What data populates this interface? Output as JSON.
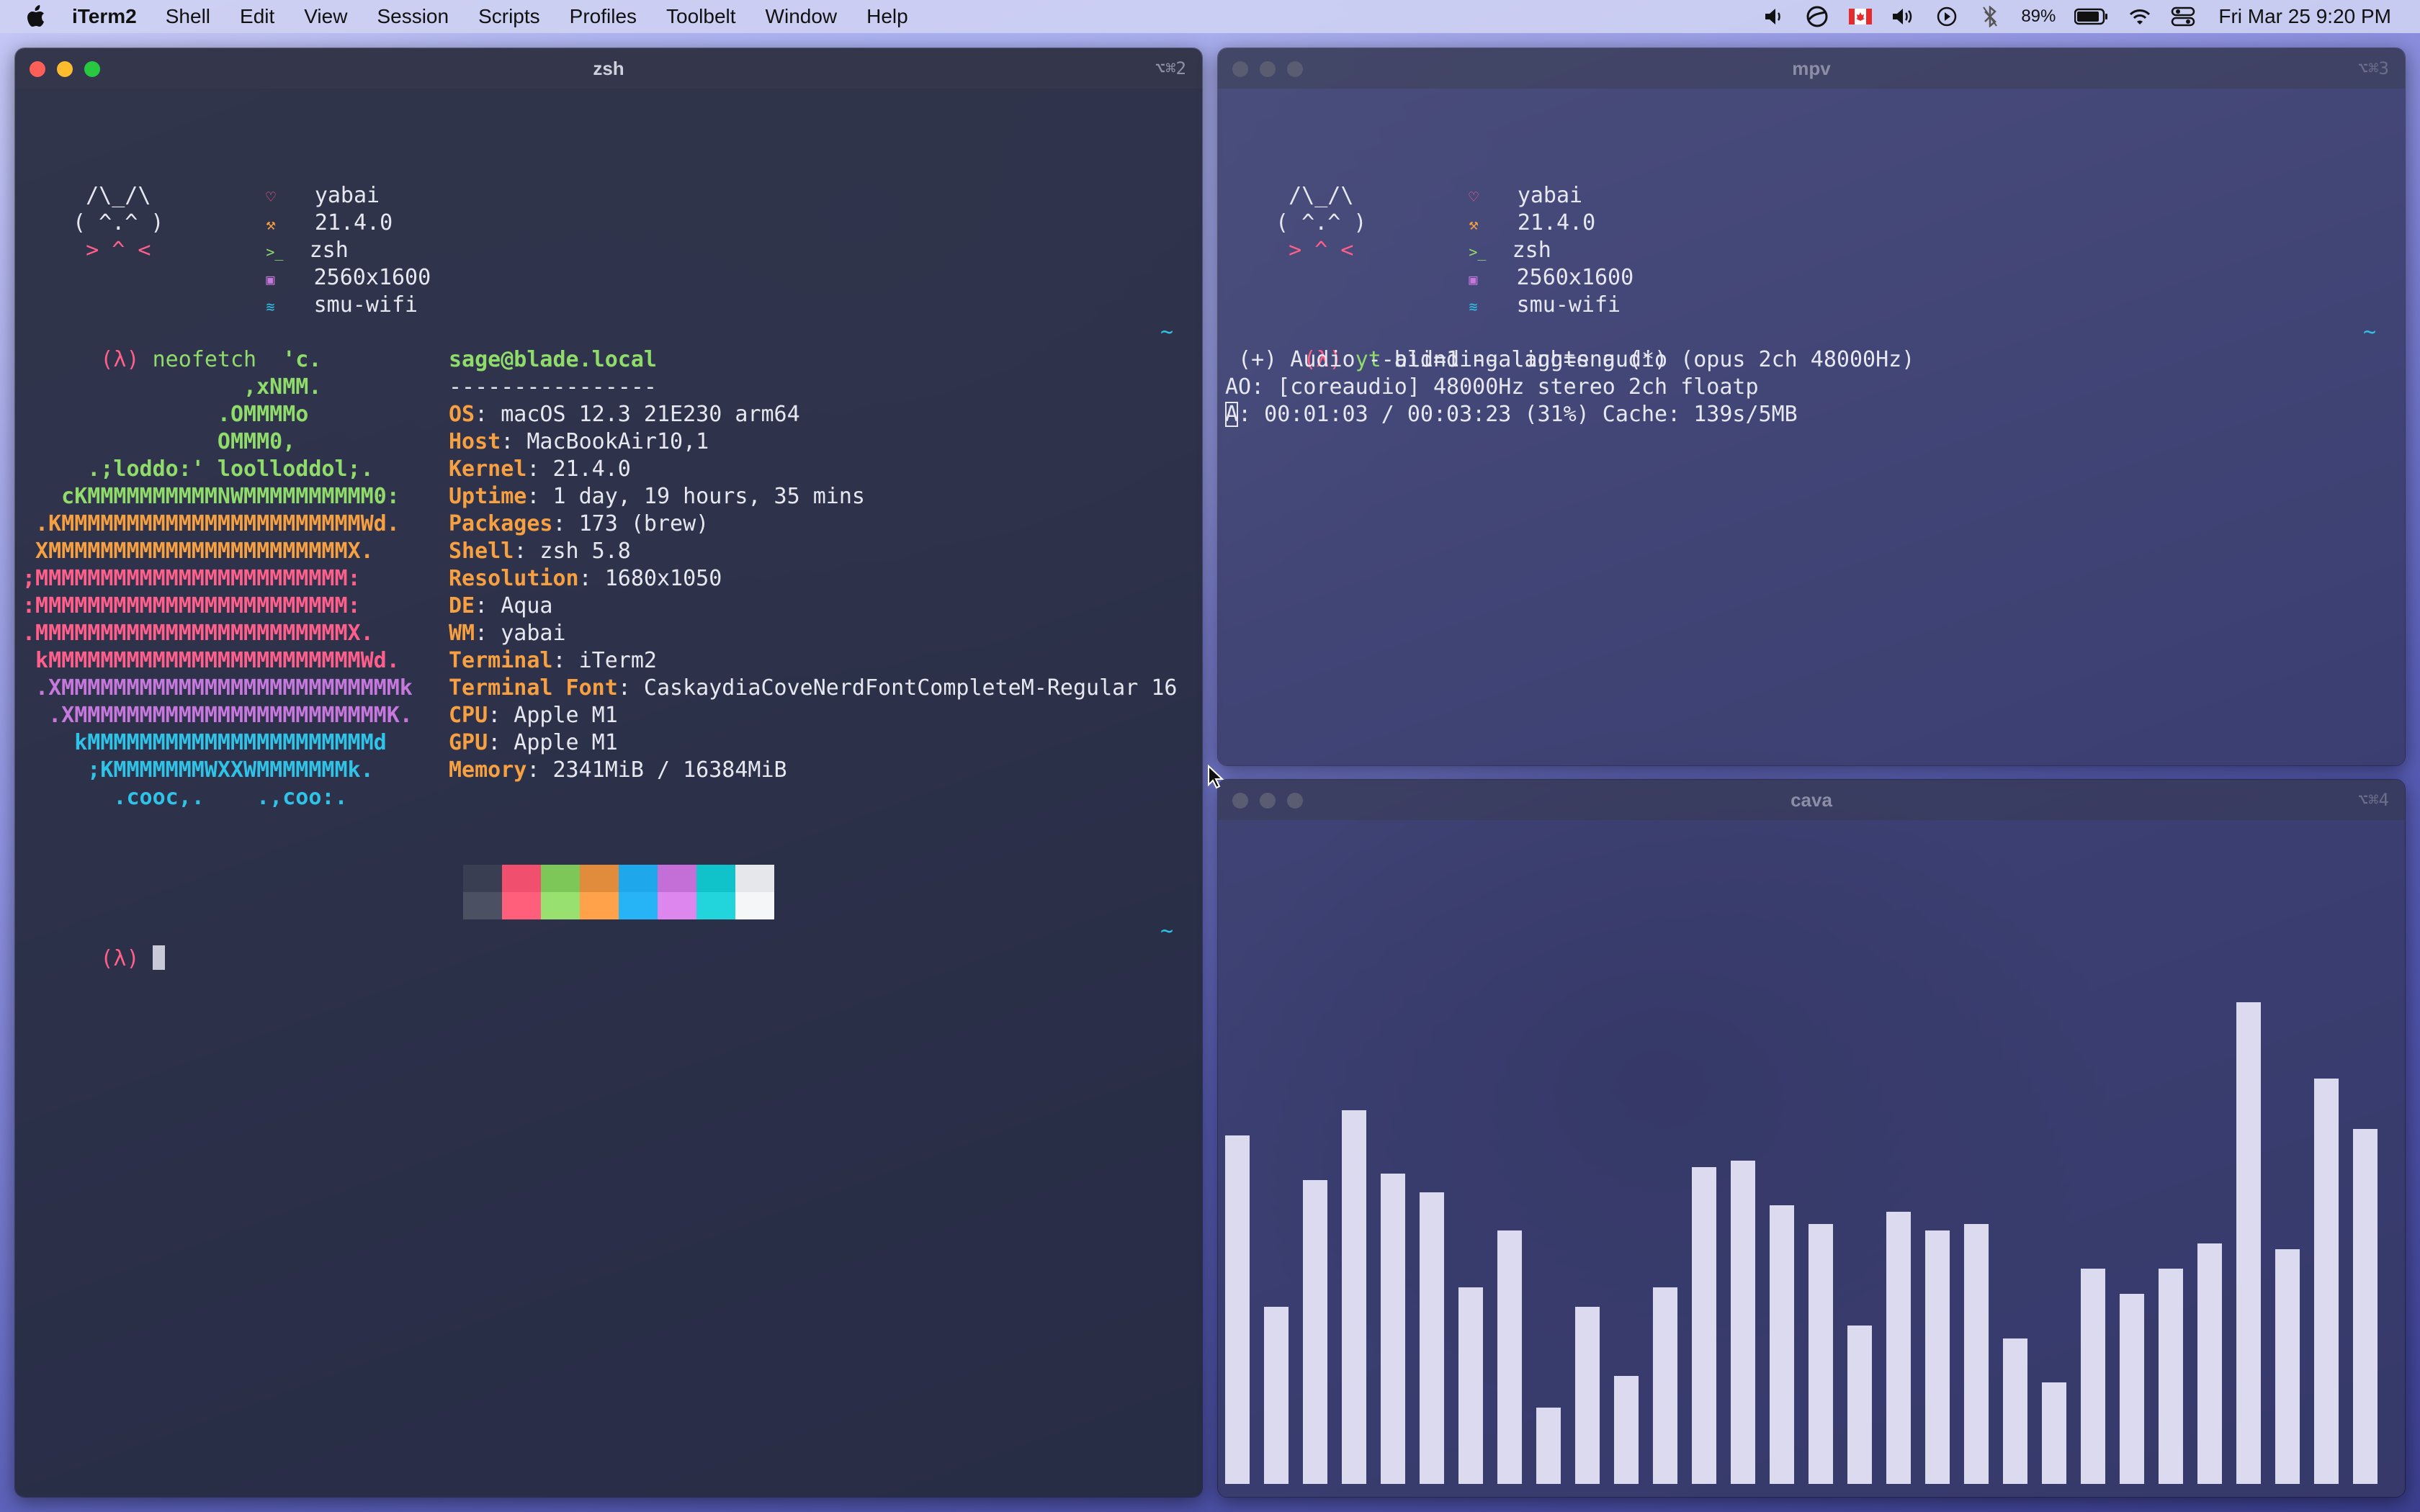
{
  "menubar": {
    "app_name": "iTerm2",
    "menus": [
      "Shell",
      "Edit",
      "View",
      "Session",
      "Scripts",
      "Profiles",
      "Toolbelt",
      "Window",
      "Help"
    ],
    "battery_percent": "89%",
    "datetime": "Fri Mar 25  9:20 PM"
  },
  "mini_fetch": {
    "art": [
      "  /\\_/\\",
      " ( ^.^ )",
      "  > ^ <"
    ],
    "items": [
      {
        "icon": "heart-icon",
        "value": "yabai"
      },
      {
        "icon": "wrench-icon",
        "value": "21.4.0"
      },
      {
        "icon": "terminal-prompt-icon",
        "value": "zsh"
      },
      {
        "icon": "image-icon",
        "value": "2560x1600"
      },
      {
        "icon": "wifi-icon",
        "value": "smu-wifi"
      }
    ]
  },
  "zsh_window": {
    "title": "zsh",
    "shortcut": "⌥⌘2",
    "prompt": "(λ)",
    "command": "neofetch",
    "tilde": "~",
    "user_host": "sage@blade.local",
    "separator": "----------------",
    "info": [
      {
        "key": "OS",
        "value": ": macOS 12.3 21E230 arm64"
      },
      {
        "key": "Host",
        "value": ": MacBookAir10,1"
      },
      {
        "key": "Kernel",
        "value": ": 21.4.0"
      },
      {
        "key": "Uptime",
        "value": ": 1 day, 19 hours, 35 mins"
      },
      {
        "key": "Packages",
        "value": ": 173 (brew)"
      },
      {
        "key": "Shell",
        "value": ": zsh 5.8"
      },
      {
        "key": "Resolution",
        "value": ": 1680x1050"
      },
      {
        "key": "DE",
        "value": ": Aqua"
      },
      {
        "key": "WM",
        "value": ": yabai"
      },
      {
        "key": "Terminal",
        "value": ": iTerm2"
      },
      {
        "key": "Terminal Font",
        "value": ": CaskaydiaCoveNerdFontCompleteM-Regular 16"
      },
      {
        "key": "CPU",
        "value": ": Apple M1"
      },
      {
        "key": "GPU",
        "value": ": Apple M1"
      },
      {
        "key": "Memory",
        "value": ": 2341MiB / 16384MiB"
      }
    ],
    "logo": [
      "                    'c.",
      "                 ,xNMM.",
      "               .OMMMMo",
      "               OMMM0,",
      "     .;loddo:' loolloddol;.",
      "   cKMMMMMMMMMMNWMMMMMMMMMM0:",
      " .KMMMMMMMMMMMMMMMMMMMMMMMWd.",
      " XMMMMMMMMMMMMMMMMMMMMMMMX.",
      ";MMMMMMMMMMMMMMMMMMMMMMMM:",
      ":MMMMMMMMMMMMMMMMMMMMMMMM:",
      ".MMMMMMMMMMMMMMMMMMMMMMMMX.",
      " kMMMMMMMMMMMMMMMMMMMMMMMMWd.",
      " .XMMMMMMMMMMMMMMMMMMMMMMMMMMk",
      "  .XMMMMMMMMMMMMMMMMMMMMMMMMK.",
      "    kMMMMMMMMMMMMMMMMMMMMMMd",
      "     ;KMMMMMMMWXXWMMMMMMMk.",
      "       .cooc,.    .,coo:."
    ],
    "logo_colors": [
      "#8fdc6b",
      "#8fdc6b",
      "#8fdc6b",
      "#8fdc6b",
      "#8fdc6b",
      "#8fdc6b",
      "#f7a042",
      "#f7a042",
      "#ff5f8a",
      "#ff5f8a",
      "#ff5f8a",
      "#ff5f8a",
      "#c678dd",
      "#c678dd",
      "#2fc3e8",
      "#2fc3e8",
      "#2fc3e8"
    ],
    "palette_top": [
      "#3a3e52",
      "#f0506e",
      "#7dc758",
      "#e08c3c",
      "#1ea7ea",
      "#c46fd8",
      "#10c2c9",
      "#e6e7ea"
    ],
    "palette_bottom": [
      "#4b5063",
      "#ff5f7a",
      "#98e06f",
      "#ffa24a",
      "#26b4f6",
      "#dd86ee",
      "#22d4dc",
      "#f5f6f8"
    ]
  },
  "mpv_window": {
    "title": "mpv",
    "shortcut": "⌥⌘3",
    "prompt": "(λ)",
    "command_name": "yt",
    "command_args": " blinding lights audio",
    "tilde": "~",
    "output": [
      " (+) Audio --aid=1 --alang=eng (*) (opus 2ch 48000Hz)",
      "AO: [coreaudio] 48000Hz stereo 2ch floatp"
    ],
    "status_box_char": "A",
    "status_rest": ": 00:01:03 / 00:03:23 (31%) Cache: 139s/5MB"
  },
  "cava_window": {
    "title": "cava",
    "shortcut": "⌥⌘4",
    "bar_levels": [
      0.55,
      0.28,
      0.48,
      0.59,
      0.49,
      0.46,
      0.31,
      0.4,
      0.12,
      0.28,
      0.17,
      0.31,
      0.5,
      0.51,
      0.44,
      0.41,
      0.25,
      0.43,
      0.4,
      0.41,
      0.23,
      0.16,
      0.34,
      0.3,
      0.34,
      0.38,
      0.76,
      0.37,
      0.64,
      0.56
    ],
    "bar_color": "#dcdaee"
  }
}
